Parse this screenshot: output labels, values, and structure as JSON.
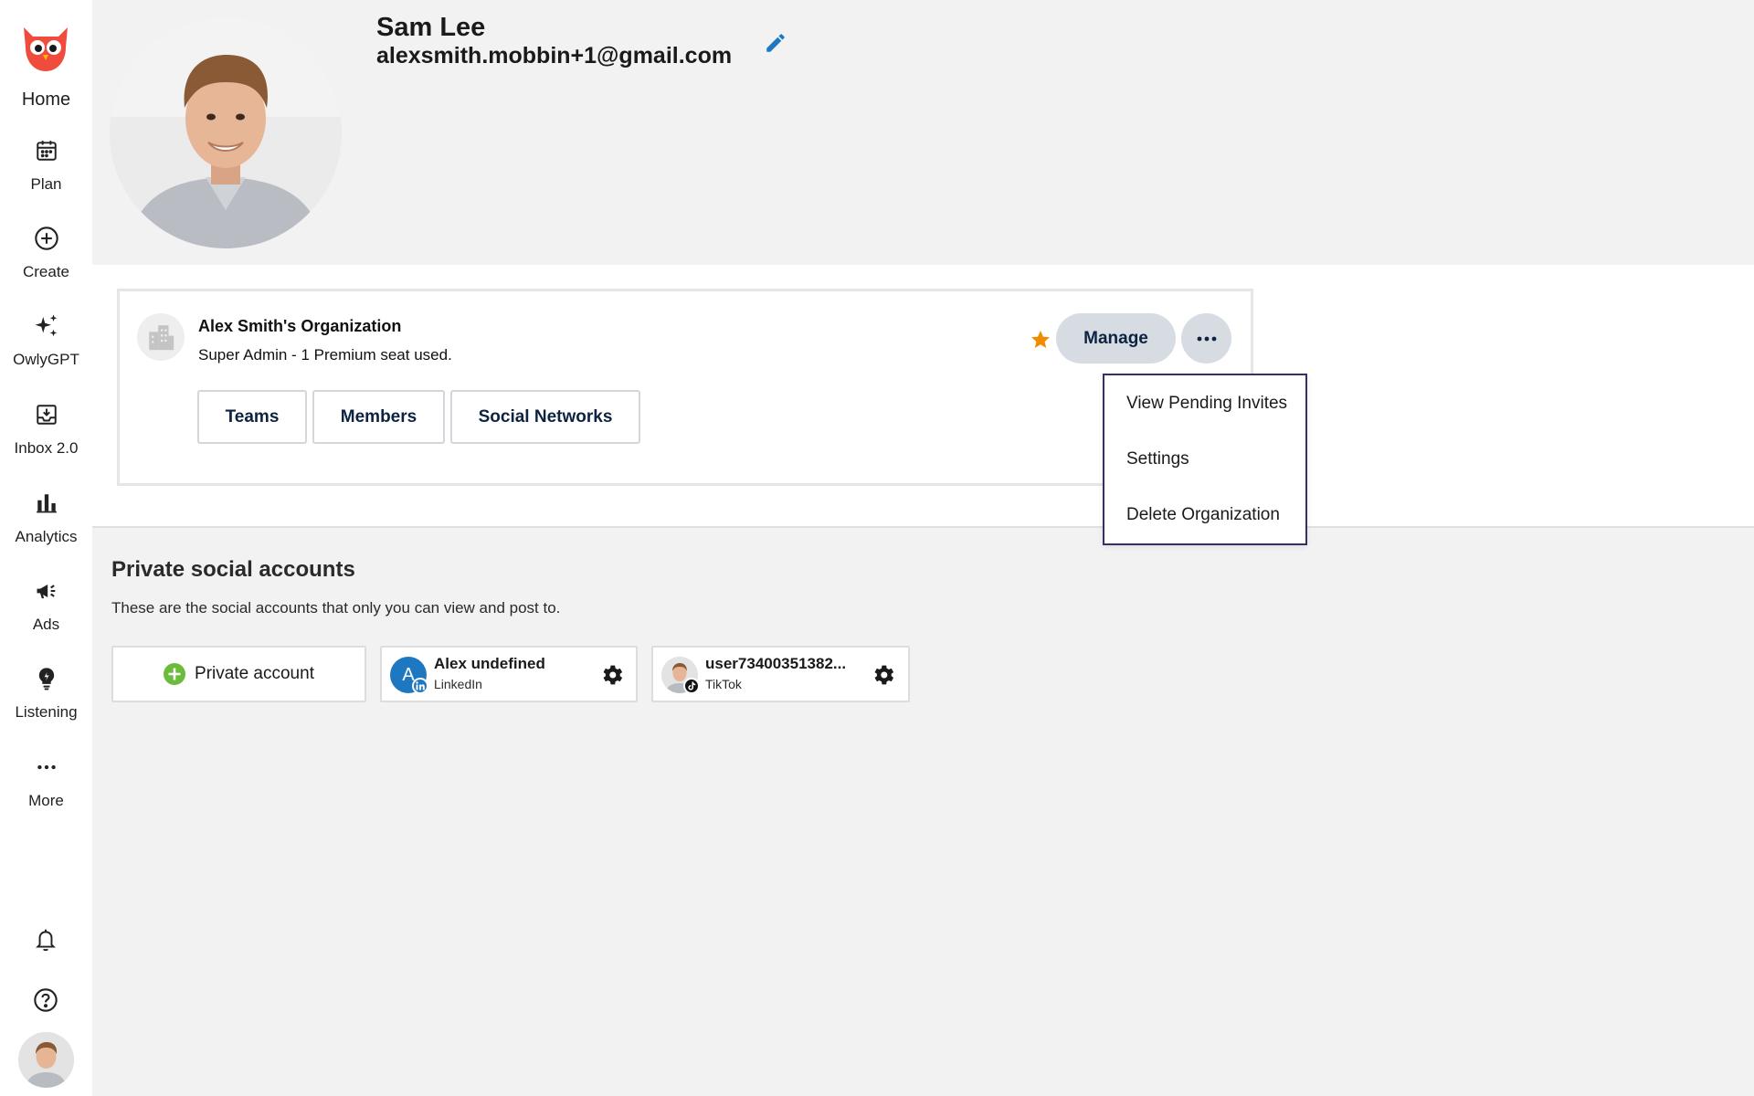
{
  "sidebar": {
    "home_label": "Home",
    "items": [
      {
        "label": "Plan",
        "icon": "calendar-icon"
      },
      {
        "label": "Create",
        "icon": "plus-circle-icon"
      },
      {
        "label": "OwlyGPT",
        "icon": "sparkle-icon"
      },
      {
        "label": "Inbox 2.0",
        "icon": "inbox-icon"
      },
      {
        "label": "Analytics",
        "icon": "bar-chart-icon"
      },
      {
        "label": "Ads",
        "icon": "megaphone-icon"
      },
      {
        "label": "Listening",
        "icon": "lightbulb-icon"
      },
      {
        "label": "More",
        "icon": "ellipsis-icon"
      }
    ]
  },
  "profile": {
    "name": "Sam Lee",
    "email": "alexsmith.mobbin+1@gmail.com"
  },
  "organization": {
    "name": "Alex Smith's Organization",
    "subtitle": "Super Admin - 1 Premium seat used.",
    "tabs": [
      "Teams",
      "Members",
      "Social Networks"
    ],
    "manage_label": "Manage"
  },
  "dropdown": {
    "items": [
      "View Pending Invites",
      "Settings",
      "Delete Organization"
    ]
  },
  "private_accounts": {
    "title": "Private social accounts",
    "subtitle": "These are the social accounts that only you can view and post to.",
    "add_label": "Private account",
    "accounts": [
      {
        "name": "Alex undefined",
        "network": "LinkedIn",
        "initial": "A"
      },
      {
        "name": "user73400351382...",
        "network": "TikTok"
      }
    ]
  },
  "colors": {
    "brand_red": "#f04c3e",
    "accent_blue": "#1d78c1",
    "star_orange": "#f08c00",
    "dropdown_border": "#3b2d6b",
    "add_green": "#6dbb3c",
    "nav_text": "#0d2340"
  }
}
